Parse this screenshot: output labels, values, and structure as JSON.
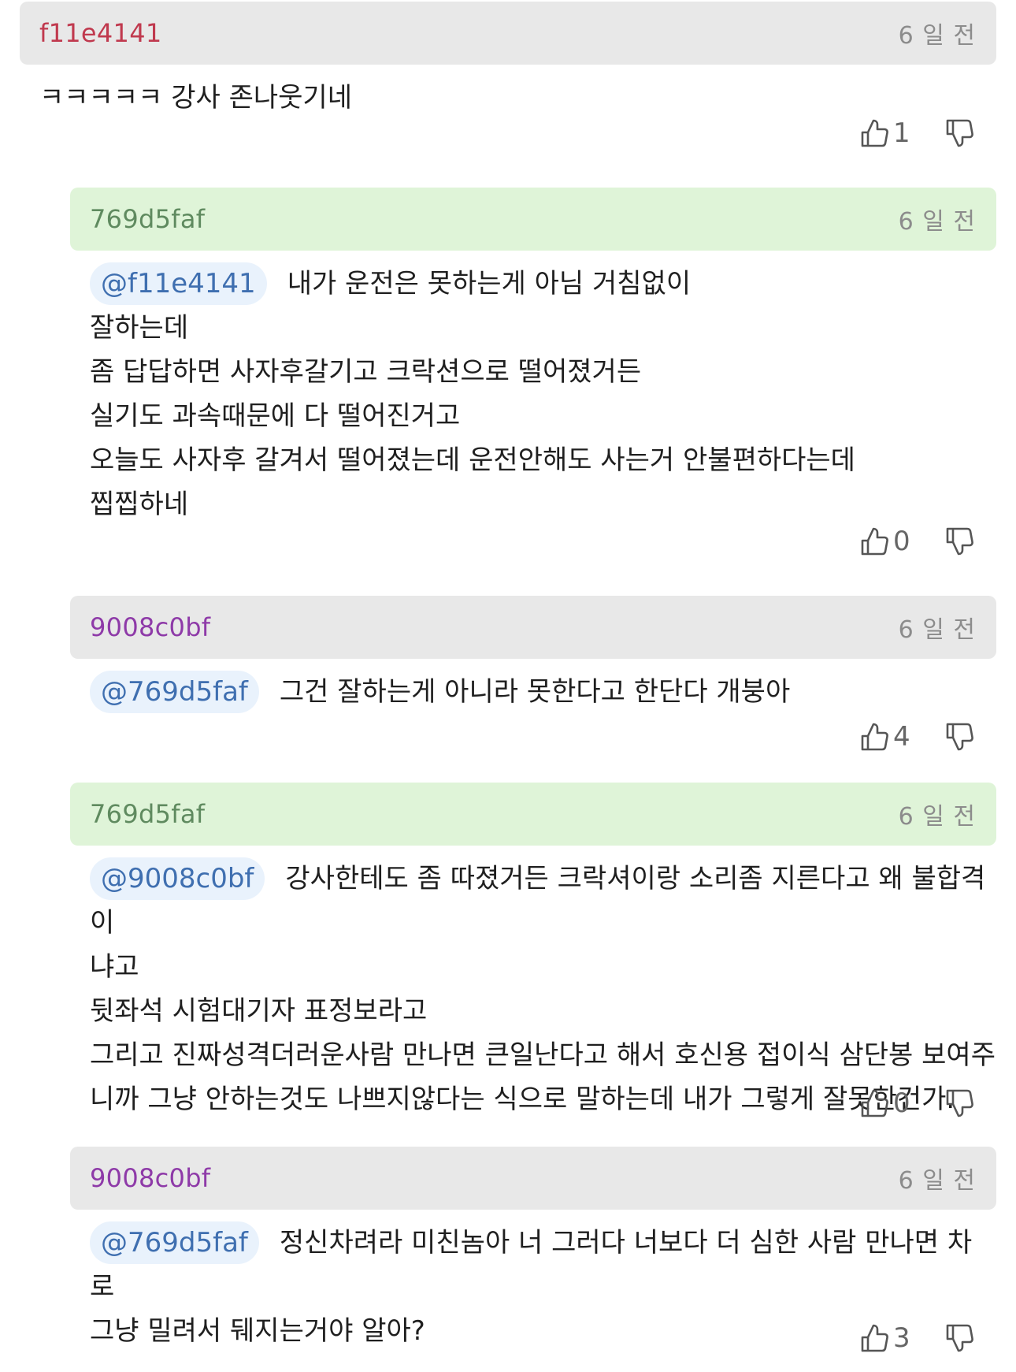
{
  "colors": {
    "user_red": "#c0394e",
    "user_green": "#5f8a5f",
    "user_purple": "#8e3aa8",
    "mention_text": "#3f6fb0",
    "mention_bg": "#e9f2fc",
    "header_grey": "#e8e8e8",
    "header_green": "#dff4d8",
    "icon": "#555555"
  },
  "comments": [
    {
      "username": "f11e4141",
      "time": "6 일 전",
      "mention": "",
      "lines": [
        "ㅋㅋㅋㅋㅋ 강사 존나웃기네"
      ],
      "likes": "1",
      "like_icon": "thumbs-up-icon",
      "dislike_icon": "thumbs-down-icon"
    },
    {
      "username": "769d5faf",
      "time": "6 일 전",
      "mention": "@f11e4141",
      "lines": [
        "내가 운전은 못하는게 아님 거침없이",
        "잘하는데",
        "좀 답답하면 사자후갈기고 크락션으로 떨어졌거든",
        "실기도 과속때문에 다 떨어진거고",
        "오늘도 사자후 갈겨서 떨어졌는데 운전안해도 사는거 안불편하다는데",
        "찝찝하네"
      ],
      "likes": "0",
      "like_icon": "thumbs-up-icon",
      "dislike_icon": "thumbs-down-icon"
    },
    {
      "username": "9008c0bf",
      "time": "6 일 전",
      "mention": "@769d5faf",
      "lines": [
        "그건 잘하는게 아니라 못한다고 한단다 개붕아"
      ],
      "likes": "4",
      "like_icon": "thumbs-up-icon",
      "dislike_icon": "thumbs-down-icon"
    },
    {
      "username": "769d5faf",
      "time": "6 일 전",
      "mention": "@9008c0bf",
      "lines": [
        "강사한테도 좀 따졌거든 크락셔이랑 소리좀 지른다고 왜 불합격이",
        "냐고",
        "뒷좌석 시험대기자 표정보라고",
        "그리고 진짜성격더러운사람 만나면 큰일난다고 해서 호신용 접이식 삼단봉 보여주",
        "니까 그냥 안하는것도 나쁘지않다는 식으로 말하는데 내가 그렇게 잘못한건가."
      ],
      "likes": "0",
      "like_icon": "thumbs-up-icon",
      "dislike_icon": "thumbs-down-icon"
    },
    {
      "username": "9008c0bf",
      "time": "6 일 전",
      "mention": "@769d5faf",
      "lines": [
        "정신차려라 미친놈아 너 그러다 너보다 더 심한 사람 만나면 차로",
        "그냥 밀려서 뒈지는거야 알아?"
      ],
      "likes": "3",
      "like_icon": "thumbs-up-icon",
      "dislike_icon": "thumbs-down-icon"
    }
  ]
}
